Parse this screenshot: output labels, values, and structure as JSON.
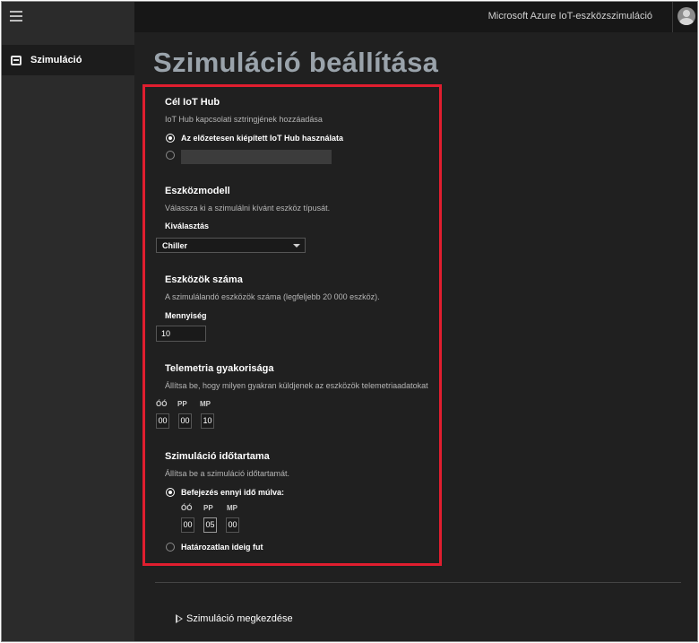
{
  "header": {
    "app_title": "Microsoft Azure IoT-eszközszimuláció"
  },
  "sidebar": {
    "items": [
      {
        "label": "Szimuláció",
        "icon": "device-icon"
      }
    ]
  },
  "page": {
    "title": "Szimuláció beállítása"
  },
  "iot_hub": {
    "title": "Cél IoT Hub",
    "description": "IoT Hub kapcsolati sztringjének hozzáadása",
    "option_preprovisioned": "Az előzetesen kiépített IoT Hub használata",
    "option_preprovisioned_selected": true,
    "connection_string_value": ""
  },
  "device_model": {
    "title": "Eszközmodell",
    "description": "Válassza ki a szimulálni kívánt eszköz típusát.",
    "select_label": "Kiválasztás",
    "selected_value": "Chiller"
  },
  "device_count": {
    "title": "Eszközök száma",
    "description": "A szimulálandó eszközök száma (legfeljebb 20 000 eszköz).",
    "field_label": "Mennyiség",
    "value": "10"
  },
  "telemetry": {
    "title": "Telemetria gyakorisága",
    "description": "Állítsa be, hogy milyen gyakran küldjenek az eszközök telemetriaadatokat",
    "labels": {
      "hours": "ÓÓ",
      "minutes": "PP",
      "seconds": "MP"
    },
    "values": {
      "hours": "00",
      "minutes": "00",
      "seconds": "10"
    }
  },
  "duration": {
    "title": "Szimuláció időtartama",
    "description": "Állítsa be a szimuláció időtartamát.",
    "option_end_after": "Befejezés ennyi idő múlva:",
    "option_end_after_selected": true,
    "labels": {
      "hours": "ÓÓ",
      "minutes": "PP",
      "seconds": "MP"
    },
    "values": {
      "hours": "00",
      "minutes": "05",
      "seconds": "00"
    },
    "option_indefinite": "Határozatlan ideig fut"
  },
  "actions": {
    "start_label": "Szimuláció megkezdése"
  },
  "colors": {
    "highlight_border": "#e01e2f",
    "background": "#202020",
    "sidebar": "#2b2b2b",
    "topbar": "#171717"
  }
}
